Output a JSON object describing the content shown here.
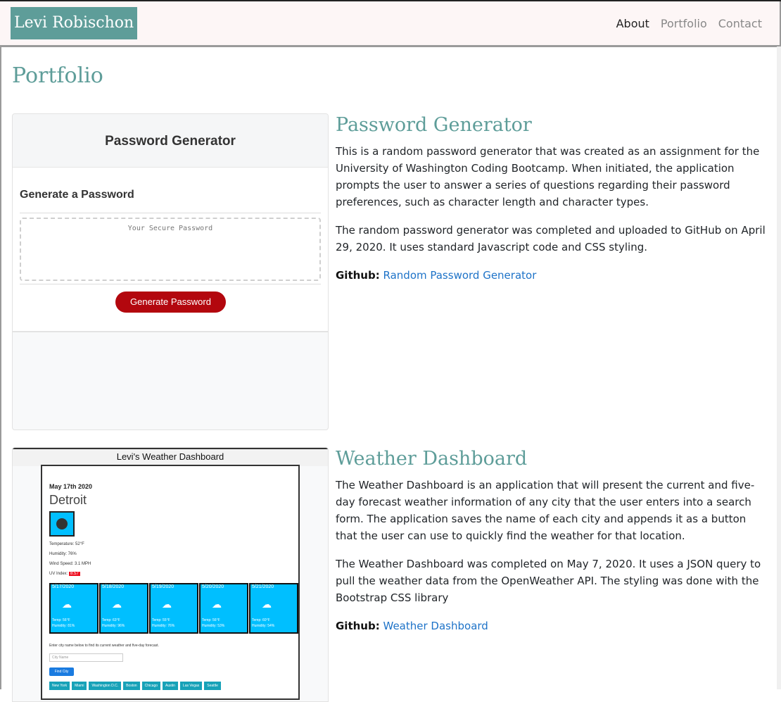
{
  "navbar": {
    "brand": "Levi Robischon",
    "links": [
      {
        "label": "About"
      },
      {
        "label": "Portfolio"
      },
      {
        "label": "Contact"
      }
    ]
  },
  "page": {
    "title": "Portfolio"
  },
  "projects": [
    {
      "title": "Password Generator",
      "paragraphs": [
        "This is a random password generator that was created as an assignment for the University of Washington Coding Bootcamp. When initiated, the application prompts the user to answer a series of questions regarding their password preferences, such as character length and character types.",
        "The random password generator was completed and uploaded to GitHub on April 29, 2020. It uses standard Javascript code and CSS styling."
      ],
      "github_label": "Github:",
      "github_link": "Random Password Generator",
      "preview": {
        "header": "Password Generator",
        "subheader": "Generate a Password",
        "placeholder": "Your Secure Password",
        "button": "Generate Password"
      }
    },
    {
      "title": "Weather Dashboard",
      "paragraphs": [
        "The Weather Dashboard is an application that will present the current and five-day forecast weather information of any city that the user enters into a search form. The application saves the name of each city and appends it as a button that the user can use to quickly find the weather for that location.",
        "The Weather Dashboard was completed on May 7, 2020. It uses a JSON query to pull the weather data from the OpenWeather API. The styling was done with the Bootstrap CSS library"
      ],
      "github_label": "Github:",
      "github_link": "Weather Dashboard",
      "preview": {
        "header": "Levi's Weather Dashboard",
        "date": "May 17th 2020",
        "city": "Detroit",
        "temperature": "Temperature: 52°F",
        "humidity": "Humidity: 76%",
        "wind": "Wind Speed: 3.1 MPH",
        "uv_label": "UV Index:",
        "uv_value": "8.57",
        "forecast": [
          {
            "date": "5/17/2020",
            "temp": "Temp: 56°F",
            "humidity": "Humidity: 81%"
          },
          {
            "date": "5/18/2020",
            "temp": "Temp: 63°F",
            "humidity": "Humidity: 96%"
          },
          {
            "date": "5/19/2020",
            "temp": "Temp: 55°F",
            "humidity": "Humidity: 76%"
          },
          {
            "date": "5/20/2020",
            "temp": "Temp: 56°F",
            "humidity": "Humidity: 53%"
          },
          {
            "date": "5/21/2020",
            "temp": "Temp: 60°F",
            "humidity": "Humidity: 54%"
          }
        ],
        "help": "Enter city name below to find its current weather and five-day forecast.",
        "input_placeholder": "City Name",
        "find_button": "Find City",
        "cities": [
          "New York",
          "Miami",
          "Washington D.C.",
          "Boston",
          "Chicago",
          "Austin",
          "Las Vegas",
          "Seattle"
        ]
      }
    }
  ]
}
